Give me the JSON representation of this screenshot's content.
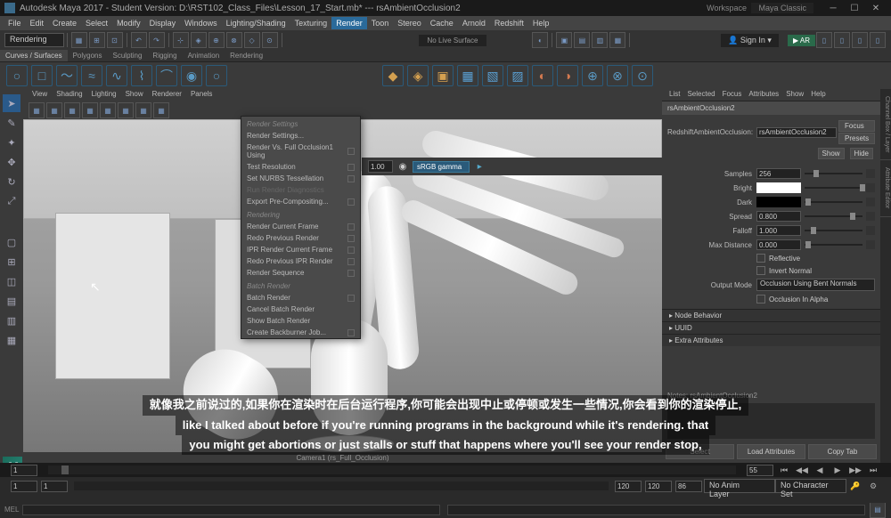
{
  "titlebar": {
    "title": "Autodesk Maya 2017 - Student Version: D:\\RST102_Class_Files\\Lesson_17_Start.mb*  ---  rsAmbientOcclusion2",
    "workspace": "Workspace",
    "workspace_value": "Maya Classic"
  },
  "menubar": {
    "items": [
      "File",
      "Edit",
      "Create",
      "Select",
      "Modify",
      "Display",
      "Windows",
      "Lighting/Shading",
      "Texturing",
      "Render",
      "Toon",
      "Stereo",
      "Cache",
      "Arnold",
      "Redshift",
      "Help"
    ],
    "active": "Render"
  },
  "toolbar": {
    "mode": "Rendering",
    "no_live": "No Live Surface",
    "signin": "Sign In"
  },
  "shelf_tabs": [
    "Curves / Surfaces",
    "Polygons",
    "Sculpting",
    "Rigging",
    "Animation",
    "Rendering"
  ],
  "render_menu": {
    "items": [
      {
        "label": "Render Settings",
        "header": true
      },
      {
        "label": "Render Settings...",
        "opt": false
      },
      {
        "label": "Render Vs. Full Occlusion1 Using",
        "opt": true
      },
      {
        "label": "Test Resolution",
        "opt": true
      },
      {
        "label": "Set NURBS Tessellation",
        "opt": true
      },
      {
        "label": "Run Render Diagnostics",
        "disabled": true
      },
      {
        "label": "Export Pre-Compositing...",
        "opt": true
      },
      {
        "label": "Rendering",
        "header": true
      },
      {
        "label": "Render Current Frame",
        "opt": true
      },
      {
        "label": "Redo Previous Render",
        "opt": true
      },
      {
        "label": "IPR Render Current Frame",
        "opt": true
      },
      {
        "label": "Redo Previous IPR Render",
        "opt": true
      },
      {
        "label": "Render Sequence",
        "opt": true
      },
      {
        "label": "Batch Render",
        "header": true
      },
      {
        "label": "Batch Render",
        "opt": true
      },
      {
        "label": "Cancel Batch Render",
        "opt": false
      },
      {
        "label": "Show Batch Render",
        "opt": false
      },
      {
        "label": "Create Backburner Job...",
        "opt": true
      }
    ]
  },
  "viewport": {
    "menu_items": [
      "View",
      "Shading",
      "Lighting",
      "Show",
      "Renderer",
      "Panels"
    ],
    "toolbar_val": "1.00",
    "gamma": "sRGB gamma",
    "camera_label": "Camera1 (rs_Full_Occlusion)"
  },
  "attr_panel": {
    "menu": [
      "List",
      "Selected",
      "Focus",
      "Attributes",
      "Show",
      "Help"
    ],
    "node_name": "rsAmbientOcclusion2",
    "type_label": "RedshiftAmbientOcclusion:",
    "type_value": "rsAmbientOcclusion2",
    "focus_btn": "Focus",
    "presets_btn": "Presets",
    "show_btn": "Show",
    "hide_btn": "Hide",
    "samples_label": "Samples",
    "samples_val": "256",
    "bright_label": "Bright",
    "dark_label": "Dark",
    "spread_label": "Spread",
    "spread_val": "0.800",
    "falloff_label": "Falloff",
    "falloff_val": "1.000",
    "max_dist_label": "Max Distance",
    "max_dist_val": "0.000",
    "reflective_label": "Reflective",
    "invert_label": "Invert Normal",
    "output_mode_label": "Output Mode",
    "output_mode_val": "Occlusion Using Bent Normals",
    "occ_alpha_label": "Occlusion In Alpha",
    "sections": [
      "Node Behavior",
      "UUID",
      "Extra Attributes"
    ],
    "notes_label": "Notes:  rsAmbientOcclusion2",
    "select_btn": "Select",
    "load_attr_btn": "Load Attributes",
    "copy_tab_btn": "Copy Tab"
  },
  "timeline": {
    "start": "1",
    "start_range": "1",
    "end_range": "120",
    "end": "120",
    "current": "55",
    "no_anim": "No Anim Layer",
    "no_char": "No Character Set",
    "fps": "86"
  },
  "statusbar": {
    "mel": "MEL"
  },
  "subtitles": {
    "line1": "就像我之前说过的,如果你在渲染时在后台运行程序,你可能会出现中止或停顿或发生一些情况,你会看到你的渲染停止,",
    "line2": "like I talked about before if you're running programs in the background while it's rendering. that",
    "line3": "you might get abortions or just stalls or stuff that happens where you'll see your render stop,"
  },
  "right_tabs": [
    "Channel Box / Layer",
    "Attribute Editor"
  ]
}
